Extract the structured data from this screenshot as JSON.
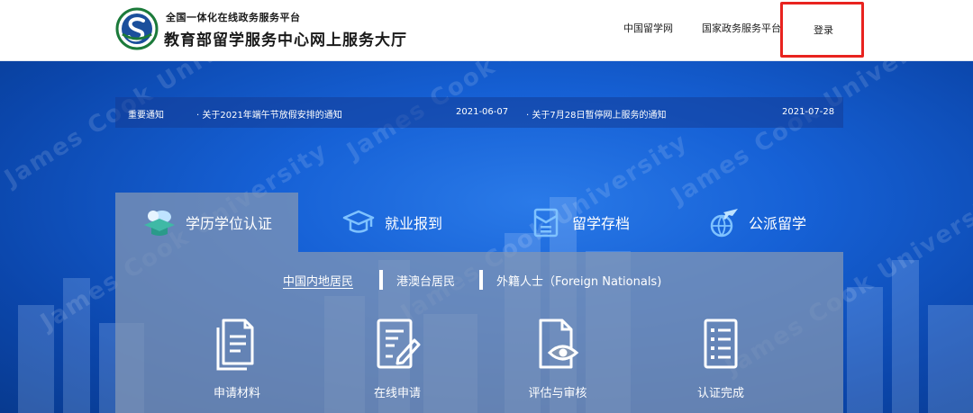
{
  "header": {
    "logo_subtitle": "全国一体化在线政务服务平台",
    "logo_title": "教育部留学服务中心网上服务大厅",
    "nav": [
      {
        "label": "中国留学网"
      },
      {
        "label": "国家政务服务平台"
      }
    ],
    "login_label": "登录"
  },
  "notices": {
    "label": "重要通知",
    "items": [
      {
        "title": "· 关于2021年端午节放假安排的通知",
        "date": "2021-06-07"
      },
      {
        "title": "· 关于7月28日暂停网上服务的通知",
        "date": "2021-07-28"
      }
    ]
  },
  "tabs": [
    {
      "label": "学历学位认证",
      "icon": "graduation-cap-icon",
      "active": true
    },
    {
      "label": "就业报到",
      "icon": "mortarboard-icon",
      "active": false
    },
    {
      "label": "留学存档",
      "icon": "document-archive-icon",
      "active": false
    },
    {
      "label": "公派留学",
      "icon": "airplane-globe-icon",
      "active": false
    }
  ],
  "sub_tabs": [
    {
      "label": "中国内地居民",
      "active": true
    },
    {
      "label": "港澳台居民",
      "active": false
    },
    {
      "label": "外籍人士（Foreign Nationals)",
      "active": false
    }
  ],
  "steps": [
    {
      "label": "申请材料",
      "icon": "documents-icon"
    },
    {
      "label": "在线申请",
      "icon": "edit-form-icon"
    },
    {
      "label": "评估与审核",
      "icon": "document-eye-icon"
    },
    {
      "label": "认证完成",
      "icon": "checklist-icon"
    }
  ],
  "watermark_text": "James Cook University",
  "colors": {
    "accent_red": "#e8231f",
    "hero_blue": "#1661d6",
    "panel_gray": "#8296b4"
  }
}
